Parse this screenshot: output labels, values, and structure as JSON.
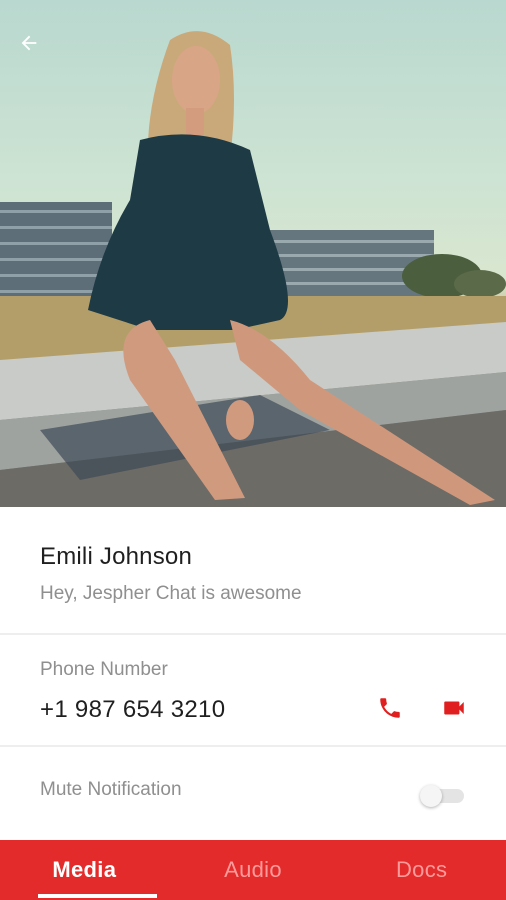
{
  "header": {
    "back_icon": "arrow-left-icon",
    "photo": "profile-cover-photo"
  },
  "profile": {
    "name": "Emili Johnson",
    "status": "Hey, Jespher Chat is awesome"
  },
  "phone": {
    "label": "Phone Number",
    "number": "+1 987 654 3210",
    "call_icon": "phone-icon",
    "video_icon": "video-camera-icon"
  },
  "mute": {
    "label": "Mute Notification",
    "enabled": false
  },
  "tabs": [
    {
      "label": "Media",
      "active": true
    },
    {
      "label": "Audio",
      "active": false
    },
    {
      "label": "Docs",
      "active": false
    }
  ],
  "colors": {
    "accent": "#e32b2b",
    "icon_red": "#e02020",
    "text_primary": "#1f1f1f",
    "text_secondary": "#8f8f8f"
  }
}
